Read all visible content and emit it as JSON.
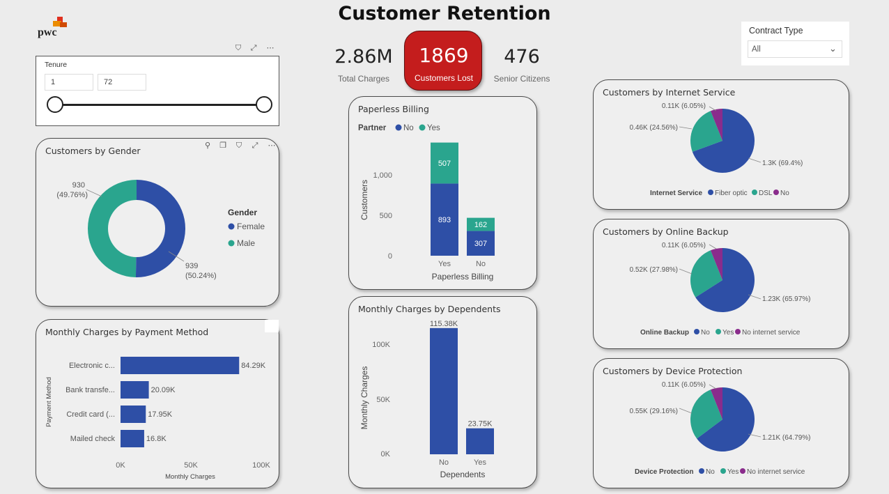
{
  "title": "Customer Retention",
  "logo_text": "pwc",
  "kpis": {
    "total_charges_value": "2.86M",
    "total_charges_label": "Total Charges",
    "customers_lost_value": "1869",
    "customers_lost_label": "Customers Lost",
    "senior_citizens_value": "476",
    "senior_citizens_label": "Senior Citizens"
  },
  "tenure_slicer": {
    "title": "Tenure",
    "min_value": "1",
    "max_value": "72"
  },
  "contract_slicer": {
    "title": "Contract Type",
    "selected": "All"
  },
  "colors": {
    "blue": "#2e4fa6",
    "teal": "#2aa58e",
    "purple": "#8a2c8c",
    "red": "#c41d1d"
  },
  "charts": {
    "gender": {
      "title": "Customers by Gender",
      "legend_title": "Gender",
      "legend": [
        "Female",
        "Male"
      ],
      "labels": {
        "male_value": "930",
        "male_pct": "(49.76%)",
        "female_value": "939",
        "female_pct": "(50.24%)"
      }
    },
    "payment": {
      "title": "Monthly Charges by Payment Method",
      "ylabel": "Payment Method",
      "xlabel": "Monthly Charges",
      "ticks": [
        "0K",
        "50K",
        "100K"
      ],
      "labels": [
        "Electronic c...",
        "Bank transfe...",
        "Credit card (...",
        "Mailed check"
      ],
      "value_labels": [
        "84.29K",
        "20.09K",
        "17.95K",
        "16.8K"
      ]
    },
    "paperless": {
      "title": "Paperless Billing",
      "legend_title": "Partner",
      "legend": [
        "No",
        "Yes"
      ],
      "ylabel": "Customers",
      "xlabel": "Paperless Billing",
      "yticks": [
        "1,000",
        "500",
        "0"
      ],
      "categories": [
        "Yes",
        "No"
      ],
      "labels_no": [
        "893",
        "307"
      ],
      "labels_yes": [
        "507",
        "162"
      ]
    },
    "dependents": {
      "title": "Monthly Charges by Dependents",
      "ylabel": "Monthly Charges",
      "xlabel": "Dependents",
      "yticks": [
        "100K",
        "50K",
        "0K"
      ],
      "categories": [
        "No",
        "Yes"
      ],
      "value_labels": [
        "115.38K",
        "23.75K"
      ]
    },
    "internet": {
      "title": "Customers by Internet Service",
      "legend_title": "Internet Service",
      "legend": [
        "Fiber optic",
        "DSL",
        "No"
      ],
      "labels": [
        "1.3K (69.4%)",
        "0.46K (24.56%)",
        "0.11K (6.05%)"
      ]
    },
    "backup": {
      "title": "Customers by Online Backup",
      "legend_title": "Online Backup",
      "legend": [
        "No",
        "Yes",
        "No internet service"
      ],
      "labels": [
        "1.23K (65.97%)",
        "0.52K (27.98%)",
        "0.11K (6.05%)"
      ]
    },
    "device": {
      "title": "Customers by Device Protection",
      "legend_title": "Device Protection",
      "legend": [
        "No",
        "Yes",
        "No internet service"
      ],
      "labels": [
        "1.21K (64.79%)",
        "0.55K (29.16%)",
        "0.11K (6.05%)"
      ]
    }
  },
  "chart_data": [
    {
      "type": "pie",
      "title": "Customers by Gender",
      "labels": [
        "Female",
        "Male"
      ],
      "values": [
        939,
        930
      ]
    },
    {
      "type": "bar",
      "title": "Monthly Charges by Payment Method",
      "xlabel": "Monthly Charges",
      "ylabel": "Payment Method",
      "categories": [
        "Electronic c...",
        "Bank transfe...",
        "Credit card (...",
        "Mailed check"
      ],
      "values": [
        84290,
        20090,
        17950,
        16800
      ],
      "xlim": [
        0,
        100000
      ]
    },
    {
      "type": "bar",
      "title": "Paperless Billing",
      "xlabel": "Paperless Billing",
      "ylabel": "Customers",
      "categories": [
        "Yes",
        "No"
      ],
      "series": [
        {
          "name": "No",
          "values": [
            893,
            307
          ]
        },
        {
          "name": "Yes",
          "values": [
            507,
            162
          ]
        }
      ],
      "ylim": [
        0,
        1400
      ]
    },
    {
      "type": "bar",
      "title": "Monthly Charges by Dependents",
      "xlabel": "Dependents",
      "ylabel": "Monthly Charges",
      "categories": [
        "No",
        "Yes"
      ],
      "values": [
        115380,
        23750
      ],
      "ylim": [
        0,
        118000
      ]
    },
    {
      "type": "pie",
      "title": "Customers by Internet Service",
      "labels": [
        "Fiber optic",
        "DSL",
        "No"
      ],
      "values": [
        69.4,
        24.56,
        6.05
      ]
    },
    {
      "type": "pie",
      "title": "Customers by Online Backup",
      "labels": [
        "No",
        "Yes",
        "No internet service"
      ],
      "values": [
        65.97,
        27.98,
        6.05
      ]
    },
    {
      "type": "pie",
      "title": "Customers by Device Protection",
      "labels": [
        "No",
        "Yes",
        "No internet service"
      ],
      "values": [
        64.79,
        29.16,
        6.05
      ]
    }
  ]
}
